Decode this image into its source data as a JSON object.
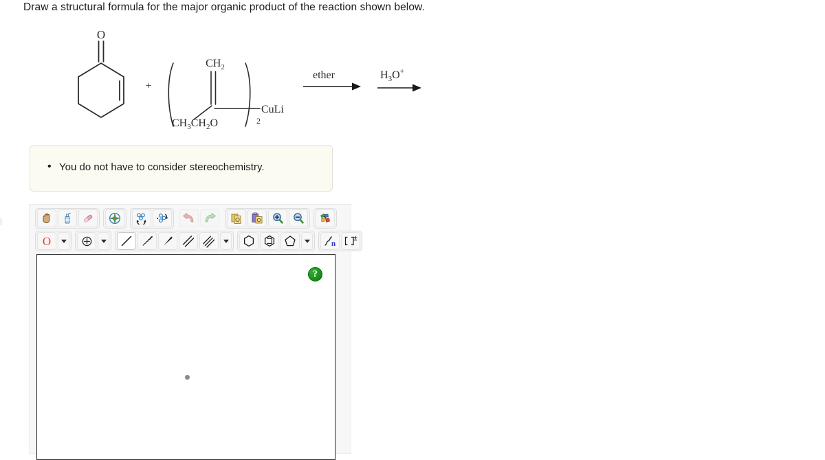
{
  "prompt": {
    "text": "Draw a structural formula for the major organic product of the reaction shown below."
  },
  "reaction": {
    "plus_sign": "+",
    "reactant1": {
      "name": "2-cyclohexen-1-one",
      "oxygen_label": "O"
    },
    "reactant2": {
      "name": "lithium di(1-ethoxyvinyl)cuprate",
      "ch2_label": "CH2",
      "ch2_label_main": "CH",
      "ch2_label_sub": "2",
      "ethoxy_label": "CH3CH2O",
      "metal_label": "CuLi",
      "paren_subscript": "2"
    },
    "arrow1": {
      "label": "ether"
    },
    "arrow2": {
      "label_main": "H",
      "label_sub": "3",
      "label_rest": "O",
      "label_sup": "+"
    }
  },
  "note": {
    "items": [
      "You do not have to consider stereochemistry."
    ]
  },
  "editor": {
    "toolbar_row1": [
      {
        "name": "pan-tool",
        "icon": "hand-icon",
        "selected": false,
        "group": 0
      },
      {
        "name": "eraser-spray-tool",
        "icon": "spray-can-icon",
        "selected": false,
        "group": 0
      },
      {
        "name": "eraser-tool",
        "icon": "eraser-icon",
        "selected": false,
        "group": 0
      },
      {
        "name": "clean-structure-tool",
        "icon": "compass-star-icon",
        "selected": false,
        "group": 1
      },
      {
        "name": "flip-horizontal-tool",
        "icon": "flip-horizontal-icon",
        "selected": false,
        "group": 2
      },
      {
        "name": "rotate-tool",
        "icon": "rotate-icon",
        "selected": false,
        "group": 2
      },
      {
        "name": "undo-button",
        "icon": "undo-arrow-icon",
        "selected": false,
        "group": 3
      },
      {
        "name": "redo-button",
        "icon": "redo-arrow-icon",
        "selected": false,
        "group": 3
      },
      {
        "name": "copy-button",
        "icon": "copy-icon",
        "selected": false,
        "group": 4
      },
      {
        "name": "paste-button",
        "icon": "paste-icon",
        "selected": false,
        "group": 4
      },
      {
        "name": "zoom-in-button",
        "icon": "magnifier-plus-icon",
        "selected": false,
        "group": 4
      },
      {
        "name": "zoom-out-button",
        "icon": "magnifier-minus-icon",
        "selected": false,
        "group": 4
      },
      {
        "name": "templates-button",
        "icon": "colored-fragments-icon",
        "selected": false,
        "group": 5
      }
    ],
    "atom_selector": {
      "label": "O",
      "color": "#e8403a",
      "dropdown": "chevron-down-icon"
    },
    "charge_selector": {
      "icon": "circled-plus-icon",
      "dropdown": "chevron-down-icon"
    },
    "bond_tools": [
      {
        "name": "single-bond-tool",
        "icon": "single-bond-icon",
        "selected": true
      },
      {
        "name": "hash-wedge-bond-tool",
        "icon": "hashed-wedge-icon",
        "selected": false
      },
      {
        "name": "wedge-bond-tool",
        "icon": "solid-wedge-icon",
        "selected": false
      },
      {
        "name": "double-bond-tool",
        "icon": "double-bond-icon",
        "selected": false
      },
      {
        "name": "triple-bond-tool",
        "icon": "triple-bond-icon",
        "selected": false
      }
    ],
    "ring_tools": [
      {
        "name": "cyclohexane-ring-tool",
        "icon": "hexagon-icon",
        "selected": false
      },
      {
        "name": "benzene-ring-tool",
        "icon": "benzene-ring-icon",
        "selected": false
      },
      {
        "name": "cyclopentane-ring-tool",
        "icon": "pentagon-icon",
        "selected": false
      }
    ],
    "chain_tool": {
      "name": "variable-chain-tool",
      "icon": "chain-n-icon",
      "label": "n"
    },
    "bracket_tool": {
      "name": "bracket-charge-tool",
      "icon": "bracket-plusminus-icon",
      "label": "[ ]"
    },
    "canvas": {
      "help_label": "?",
      "help_title": "help-button"
    }
  }
}
